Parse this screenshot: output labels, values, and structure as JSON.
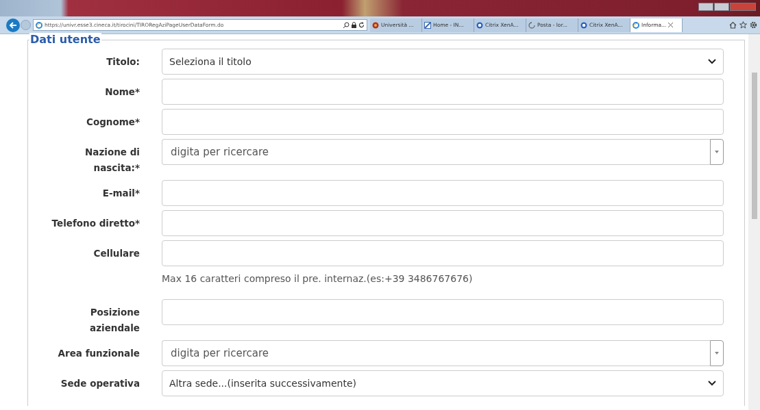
{
  "browser": {
    "address": "https://univr.esse3.cineca.it/tirocini/TIRORegAziPageUserDataForm.do",
    "tabs": [
      {
        "label": "Università ...",
        "selected": false
      },
      {
        "label": "Home - IN...",
        "selected": false
      },
      {
        "label": "Citrix XenA...",
        "selected": false
      },
      {
        "label": "Posta - lor...",
        "selected": false
      },
      {
        "label": "Citrix XenA...",
        "selected": false
      },
      {
        "label": "Informa...",
        "selected": true
      }
    ]
  },
  "form": {
    "legend": "Dati utente",
    "fields": [
      {
        "label": "Titolo:",
        "kind": "select",
        "value": "Seleziona il titolo"
      },
      {
        "label": "Nome*",
        "kind": "text"
      },
      {
        "label": "Cognome*",
        "kind": "text"
      },
      {
        "label": "Nazione di nascita:*",
        "kind": "combo",
        "placeholder": "digita per ricercare"
      },
      {
        "label": "E-mail*",
        "kind": "text"
      },
      {
        "label": "Telefono diretto*",
        "kind": "text"
      },
      {
        "label": "Cellulare",
        "kind": "text",
        "help": "Max 16 caratteri compreso il pre. internaz.(es:+39 3486767676)"
      },
      {
        "label": "Posizione aziendale",
        "kind": "text"
      },
      {
        "label": "Area funzionale",
        "kind": "combo",
        "placeholder": "digita per ricercare"
      },
      {
        "label": "Sede operativa",
        "kind": "select",
        "value": "Altra sede...(inserita successivamente)"
      }
    ]
  }
}
